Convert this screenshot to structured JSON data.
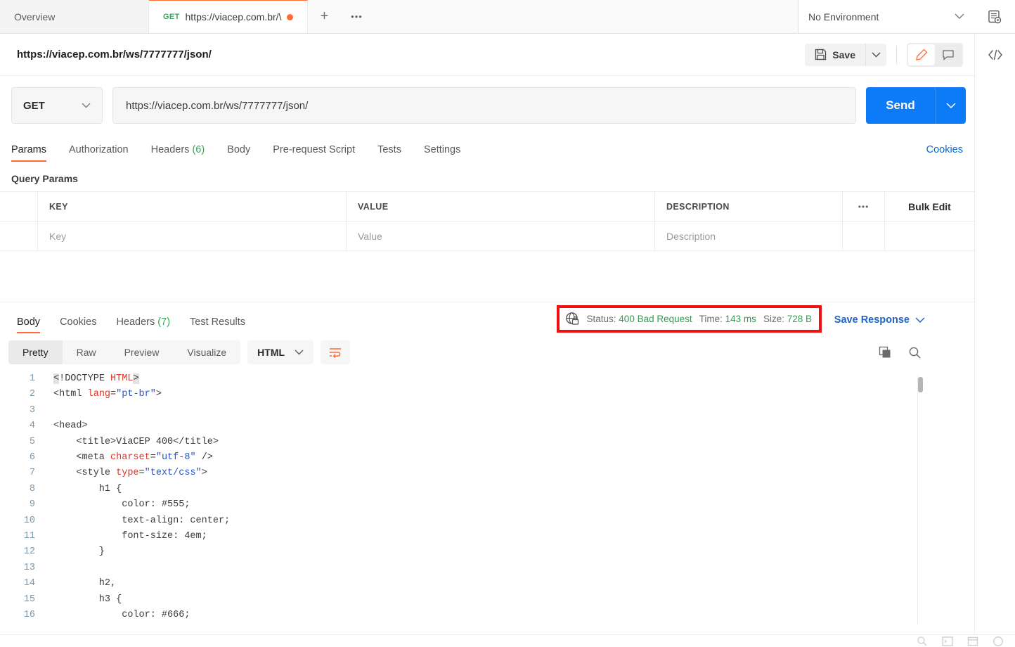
{
  "tabs": {
    "overview_label": "Overview",
    "request_tab": {
      "method": "GET",
      "title": "https://viacep.com.br/\\",
      "unsaved": "●"
    },
    "new_tab_label": "+",
    "more_label": "•••"
  },
  "environment": {
    "selected": "No Environment"
  },
  "request": {
    "title": "https://viacep.com.br/ws/7777777/json/",
    "method": "GET",
    "url": "https://viacep.com.br/ws/7777777/json/",
    "save_label": "Save",
    "send_label": "Send"
  },
  "request_tabs": [
    {
      "label": "Params",
      "count": "",
      "active": true
    },
    {
      "label": "Authorization",
      "count": "",
      "active": false
    },
    {
      "label": "Headers",
      "count": "(6)",
      "active": false
    },
    {
      "label": "Body",
      "count": "",
      "active": false
    },
    {
      "label": "Pre-request Script",
      "count": "",
      "active": false
    },
    {
      "label": "Tests",
      "count": "",
      "active": false
    },
    {
      "label": "Settings",
      "count": "",
      "active": false
    }
  ],
  "cookies_link": "Cookies",
  "params": {
    "section_label": "Query Params",
    "headers": {
      "key": "KEY",
      "value": "VALUE",
      "description": "DESCRIPTION"
    },
    "more_label": "•••",
    "bulk_edit_label": "Bulk Edit",
    "rows": [
      {
        "key_placeholder": "Key",
        "value_placeholder": "Value",
        "description_placeholder": "Description"
      }
    ]
  },
  "response_tabs": [
    {
      "label": "Body",
      "count": "",
      "active": true
    },
    {
      "label": "Cookies",
      "count": "",
      "active": false
    },
    {
      "label": "Headers",
      "count": "(7)",
      "active": false
    },
    {
      "label": "Test Results",
      "count": "",
      "active": false
    }
  ],
  "status": {
    "status_label": "Status:",
    "status_value": "400 Bad Request",
    "time_label": "Time:",
    "time_value": "143 ms",
    "size_label": "Size:",
    "size_value": "728 B",
    "highlight_color": "#ee1111",
    "value_color": "#2f9e4f"
  },
  "save_response_label": "Save Response",
  "view_modes": [
    {
      "label": "Pretty",
      "active": true
    },
    {
      "label": "Raw",
      "active": false
    },
    {
      "label": "Preview",
      "active": false
    },
    {
      "label": "Visualize",
      "active": false
    }
  ],
  "format": {
    "selected": "HTML"
  },
  "code": {
    "language": "html",
    "lines": [
      {
        "n": "1",
        "html": "<span class=\"sel-hl\">&lt;</span><span class=\"t-dt\">!DOCTYPE</span> <span class=\"t-attr\">HTML</span><span class=\"sel-hl\">&gt;</span>"
      },
      {
        "n": "2",
        "html": "<span class=\"t-tag\">&lt;html</span> <span class=\"t-attr\">lang</span>=<span class=\"t-str\">\"pt-br\"</span><span class=\"t-tag\">&gt;</span>"
      },
      {
        "n": "3",
        "html": ""
      },
      {
        "n": "4",
        "html": "<span class=\"t-tag\">&lt;head&gt;</span>"
      },
      {
        "n": "5",
        "html": "    <span class=\"t-tag\">&lt;title&gt;</span>ViaCEP 400<span class=\"t-tag\">&lt;/title&gt;</span>"
      },
      {
        "n": "6",
        "html": "    <span class=\"t-tag\">&lt;meta</span> <span class=\"t-attr\">charset</span>=<span class=\"t-str\">\"utf-8\"</span> <span class=\"t-tag\">/&gt;</span>"
      },
      {
        "n": "7",
        "html": "    <span class=\"t-tag\">&lt;style</span> <span class=\"t-attr\">type</span>=<span class=\"t-str\">\"text/css\"</span><span class=\"t-tag\">&gt;</span>"
      },
      {
        "n": "8",
        "html": "        h1 {"
      },
      {
        "n": "9",
        "html": "            color: #555;"
      },
      {
        "n": "10",
        "html": "            text-align: center;"
      },
      {
        "n": "11",
        "html": "            font-size: 4em;"
      },
      {
        "n": "12",
        "html": "        }"
      },
      {
        "n": "13",
        "html": ""
      },
      {
        "n": "14",
        "html": "        h2,"
      },
      {
        "n": "15",
        "html": "        h3 {"
      },
      {
        "n": "16",
        "html": "            color: #666;"
      }
    ]
  },
  "icons": {
    "save": "floppy-disk-icon",
    "edit": "pencil-icon",
    "comment": "comment-icon",
    "code": "code-brackets-icon",
    "env_preview": "environment-quick-look-icon",
    "status": "globe-lock-icon",
    "copy": "copy-icon",
    "search": "search-icon",
    "wrap": "word-wrap-icon"
  }
}
